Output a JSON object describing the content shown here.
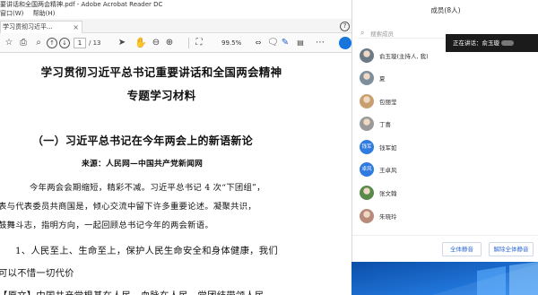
{
  "window": {
    "title": "要讲话和全国两会精神.pdf - Adobe Acrobat Reader DC",
    "menu": [
      "窗口(W)",
      "帮助(H)"
    ]
  },
  "tab": {
    "label": "学习贯彻习近平..."
  },
  "toolbar": {
    "page_current": "1",
    "page_total": "/ 13",
    "zoom": "99.5%"
  },
  "document": {
    "title_line1": "学习贯彻习近平总书记重要讲话和全国两会精神",
    "title_line2": "专题学习材料",
    "section_heading": "（一）习近平总书记在今年两会上的新语新论",
    "source": "来源：人民网—中国共产党新闻网",
    "para1": "今年两会会期缩短，精彩不减。习近平总书记 4 次“下团组”，",
    "para2": "表与代表委员共商国是，倾心交流中留下许多重要论述。凝聚共识，",
    "para3": "鼓舞斗志，指明方向，一起回顾总书记今年的两会新语。",
    "point1": "1、人民至上、生命至上，保护人民生命安全和身体健康，我们",
    "point1_cont": "可以不惜一切代价",
    "point1_next": "【原文】中国共产党根基在人民、血脉在人民。党团结带领人民"
  },
  "members_panel": {
    "title": "成员(8人)",
    "search_placeholder": "搜索成员",
    "speaking_label": "正在讲话：俞玉璇",
    "members": [
      {
        "name": "俞玉璇(主持人, 我)",
        "avatar": "photo",
        "color": "#6b7a86"
      },
      {
        "name": "夏",
        "avatar": "photo",
        "color": "#7d8f9d"
      },
      {
        "name": "包丽莹",
        "avatar": "photo",
        "color": "#c8a070"
      },
      {
        "name": "丁喜",
        "avatar": "photo",
        "color": "#9a9a9a"
      },
      {
        "name": "钱军如",
        "avatar": "钱军如",
        "color": "#2f7be0"
      },
      {
        "name": "王卓风",
        "avatar": "卓风",
        "color": "#2f7be0"
      },
      {
        "name": "张文翰",
        "avatar": "photo",
        "color": "#5a8a4a"
      },
      {
        "name": "朱晓玲",
        "avatar": "photo",
        "color": "#b88a7a"
      }
    ],
    "footer": {
      "mute_all": "全体静音",
      "unmute_all": "解除全体静音"
    }
  }
}
